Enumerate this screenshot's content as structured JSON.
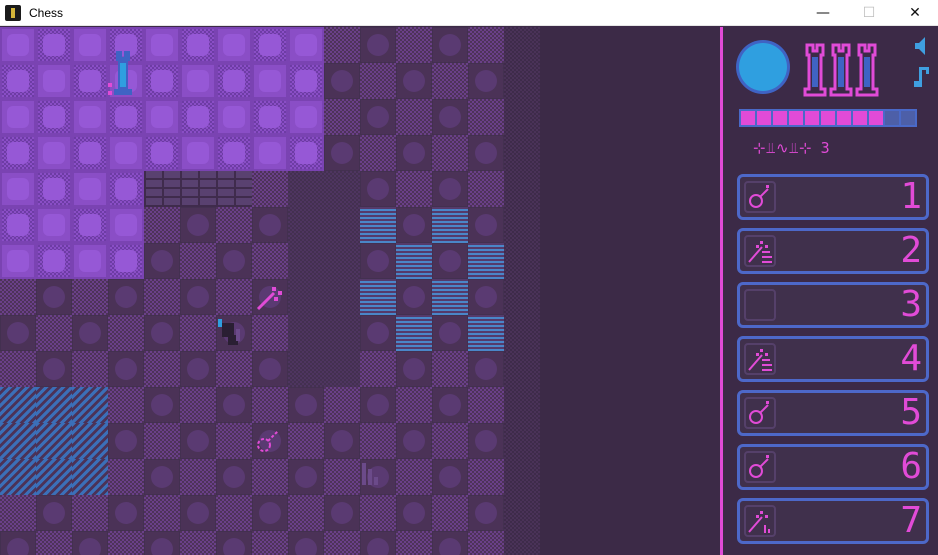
{
  "window": {
    "title": "Chess",
    "minimize": "—",
    "maximize": "☐",
    "close": "✕"
  },
  "colors": {
    "accent_pink": "#e14bd7",
    "accent_blue": "#4d68c9",
    "orb_blue": "#2f9fe0",
    "board_light": "#8a4ec6",
    "board_dark": "#4b3257"
  },
  "hud": {
    "health_orb_icon": "health-orb",
    "towers_icon": "three-rooks-icon",
    "sound_icon": "speaker-icon",
    "music_icon": "music-note-icon",
    "energy": {
      "filled": 9,
      "total": 11
    },
    "level_glyphs": "⊹⫫∿⫫⊹",
    "level_number": "3"
  },
  "inventory": [
    {
      "number": "1",
      "icon": "key"
    },
    {
      "number": "2",
      "icon": "wand"
    },
    {
      "number": "3",
      "icon": "empty"
    },
    {
      "number": "4",
      "icon": "wand"
    },
    {
      "number": "5",
      "icon": "key"
    },
    {
      "number": "6",
      "icon": "key"
    },
    {
      "number": "7",
      "icon": "wand-small"
    }
  ]
}
